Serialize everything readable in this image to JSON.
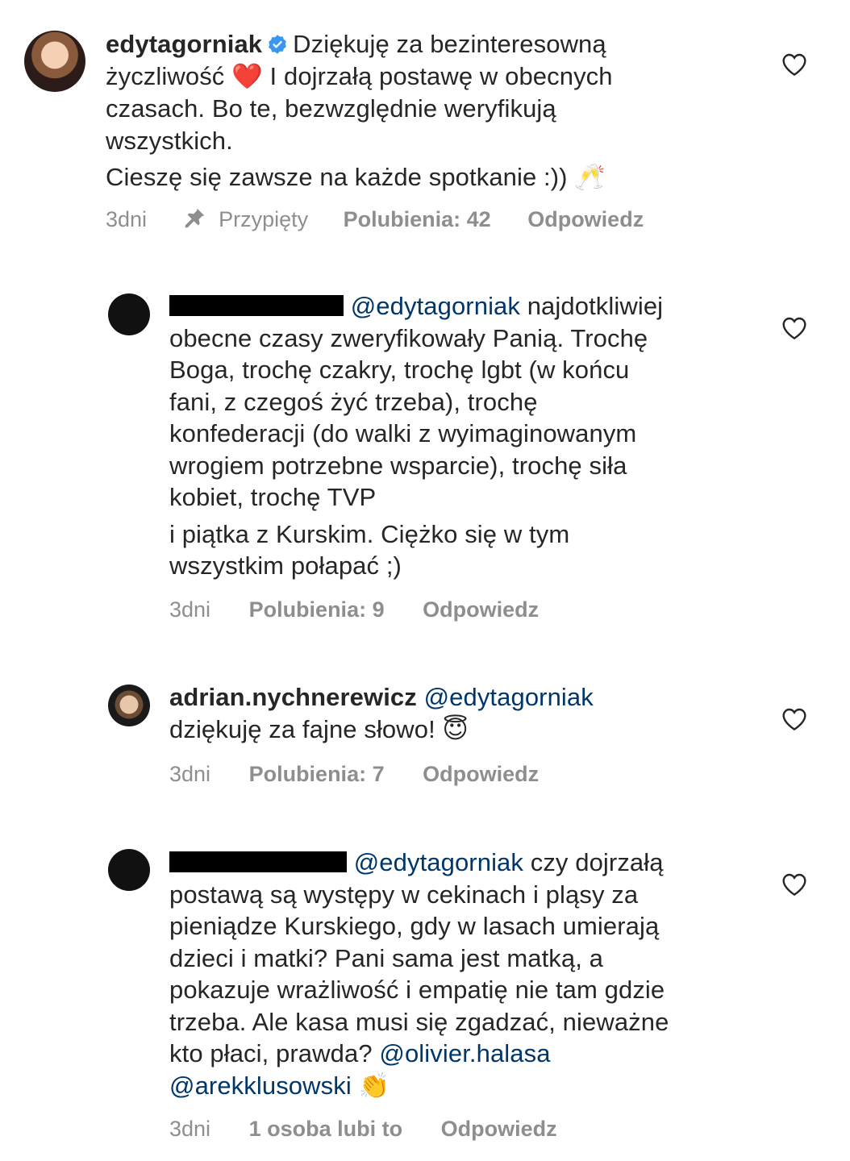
{
  "comments": [
    {
      "username": "edytagorniak",
      "lines": [
        "Dziękuję za bezinteresowną",
        "życzliwość",
        "I dojrzałą postawę w obecnych",
        "czasach. Bo te, bezwzględnie weryfikują",
        "wszystkich.",
        "Cieszę się zawsze na każde spotkanie :))"
      ],
      "heart_emoji": "❤️",
      "toast_emoji": "🥂",
      "time": "3dni",
      "pinned_label": "Przypięty",
      "likes": "Polubienia: 42",
      "reply": "Odpowiedz"
    },
    {
      "mention": "@edytagorniak",
      "lines": [
        "najdotkliwiej",
        "obecne czasy zweryfikowały Panią. Trochę",
        "Boga, trochę czakry, trochę lgbt (w końcu",
        "fani, z czegoś żyć trzeba), trochę",
        "konfederacji (do walki z wyimaginowanym",
        "wrogiem potrzebne wsparcie), trochę siła",
        "kobiet, trochę TVP",
        "i piątka z Kurskim. Ciężko się w tym",
        "wszystkim połapać ;)"
      ],
      "time": "3dni",
      "likes": "Polubienia: 9",
      "reply": "Odpowiedz"
    },
    {
      "username": "adrian.nychnerewicz",
      "mention": "@edytagorniak",
      "lines": [
        "dziękuję za fajne słowo!"
      ],
      "emoji": "😇",
      "time": "3dni",
      "likes": "Polubienia: 7",
      "reply": "Odpowiedz"
    },
    {
      "mention": "@edytagorniak",
      "lines": [
        "czy dojrzałą",
        "postawą są występy w cekinach i pląsy za",
        "pieniądze Kurskiego, gdy w lasach umierają",
        "dzieci i matki? Pani sama jest matką,  a",
        "pokazuje wrażliwość i empatię nie tam gdzie",
        "trzeba. Ale kasa musi się zgadzać, nieważne",
        "kto płaci, prawda?"
      ],
      "mention2": "@olivier.halasa",
      "mention3": "@arekklusowski",
      "emoji": "👏",
      "time": "3dni",
      "likes": "1 osoba lubi to",
      "reply": "Odpowiedz"
    }
  ],
  "colors": {
    "text": "#262626",
    "meta": "#8e8e8e",
    "mention": "#00376b",
    "verified": "#3897f0"
  }
}
